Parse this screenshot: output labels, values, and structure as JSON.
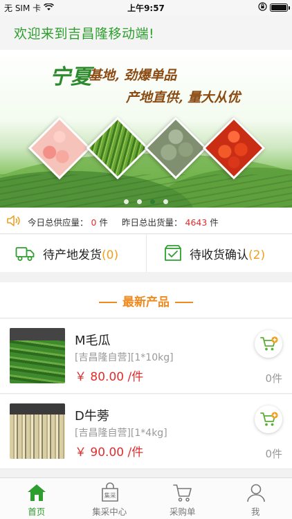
{
  "status_bar": {
    "carrier": "无 SIM 卡",
    "time": "上午9:57"
  },
  "welcome": {
    "text": "欢迎来到吉昌隆移动端!"
  },
  "banner": {
    "title": "宁夏",
    "line1": "基地, 劲爆单品",
    "line2": "产地直供, 量大从优",
    "slide_count": 4,
    "active_slide": 3
  },
  "stats": {
    "today_supply_label": "今日总供应量：",
    "today_supply_value": "0",
    "today_supply_unit": "件",
    "yesterday_out_label": "昨日总出货量：",
    "yesterday_out_value": "4643",
    "yesterday_out_unit": "件"
  },
  "pending": {
    "ship_label": "待产地发货",
    "ship_count": "(0)",
    "receive_label": "待收货确认",
    "receive_count": "(2)"
  },
  "new_products": {
    "title": "最新产品",
    "items": [
      {
        "name": "M毛瓜",
        "spec": "[吉昌隆自营][1*10kg]",
        "price": "￥ 80.00 /件",
        "qty": "0件"
      },
      {
        "name": "D牛蒡",
        "spec": "[吉昌隆自营][1*4kg]",
        "price": "￥ 90.00 /件",
        "qty": "0件"
      }
    ]
  },
  "tabbar": {
    "items": [
      {
        "label": "首页",
        "icon": "home-icon",
        "active": true
      },
      {
        "label": "集采中心",
        "icon": "bag-icon",
        "active": false
      },
      {
        "label": "采购单",
        "icon": "cart-icon",
        "active": false
      },
      {
        "label": "我",
        "icon": "person-icon",
        "active": false
      }
    ],
    "bag_text": "集采"
  },
  "colors": {
    "brand_green": "#2e9e2e",
    "accent_orange": "#f08a1e",
    "price_red": "#e02d2d"
  }
}
